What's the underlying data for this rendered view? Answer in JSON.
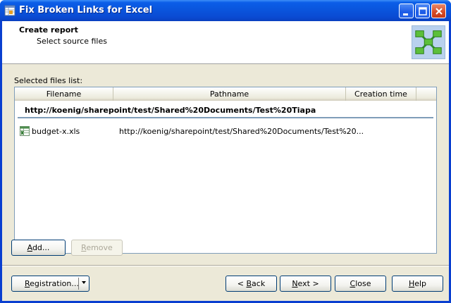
{
  "window": {
    "title": "Fix Broken Links for Excel"
  },
  "header": {
    "title": "Create report",
    "subtitle": "Select source files"
  },
  "files": {
    "label": "Selected files list:",
    "columns": [
      "Filename",
      "Pathname",
      "Creation time"
    ],
    "group": "http://koenig/sharepoint/test/Shared%20Documents/Test%20Tiapa",
    "rows": [
      {
        "filename": "budget-x.xls",
        "pathname": "http://koenig/sharepoint/test/Shared%20Documents/Test%20...",
        "creation_time": ""
      }
    ]
  },
  "buttons": {
    "add": {
      "pre": "",
      "key": "A",
      "post": "dd..."
    },
    "remove": {
      "pre": "",
      "key": "R",
      "post": "emove"
    },
    "registration": {
      "pre": "",
      "key": "R",
      "post": "egistration..."
    },
    "back": {
      "pre": "< ",
      "key": "B",
      "post": "ack"
    },
    "next": {
      "pre": "",
      "key": "N",
      "post": "ext >"
    },
    "close": {
      "pre": "",
      "key": "C",
      "post": "lose"
    },
    "help": {
      "pre": "",
      "key": "H",
      "post": "elp"
    }
  }
}
